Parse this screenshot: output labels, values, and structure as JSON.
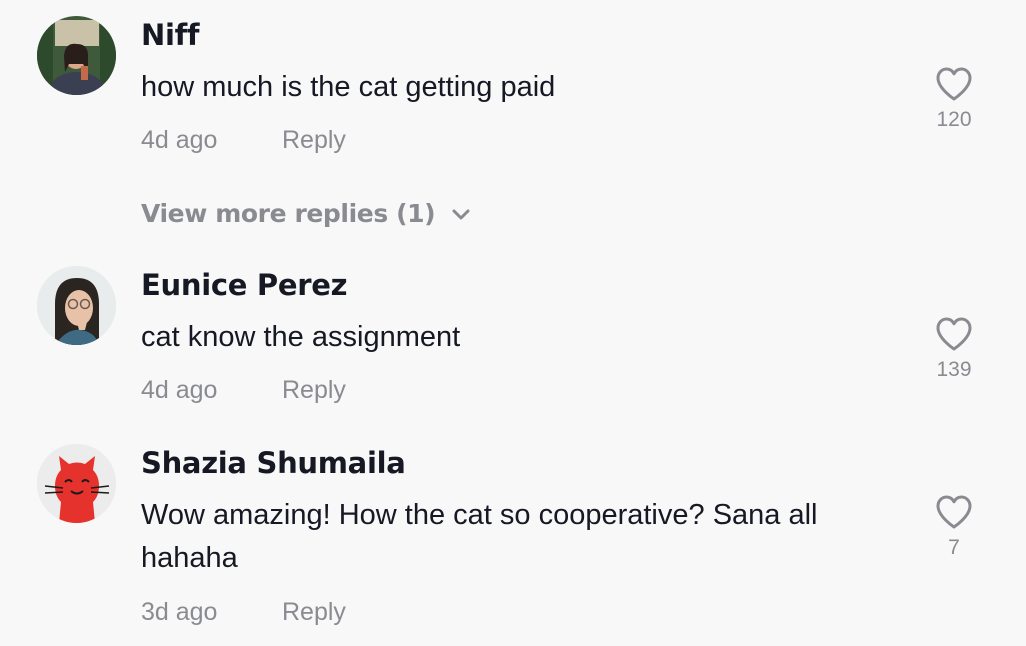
{
  "comments": [
    {
      "author": "Niff",
      "text": "how much is the cat getting paid",
      "time": "4d ago",
      "reply_label": "Reply",
      "likes": "120"
    },
    {
      "author": "Eunice Perez",
      "text": "cat know the assignment",
      "time": "4d ago",
      "reply_label": "Reply",
      "likes": "139"
    },
    {
      "author": "Shazia Shumaila",
      "text": "Wow amazing! How the cat so cooperative? Sana all hahaha",
      "time": "3d ago",
      "reply_label": "Reply",
      "likes": "7"
    }
  ],
  "view_more_replies": "View more replies (1)",
  "colors": {
    "background": "#f8f8f8",
    "primary_text": "#161823",
    "secondary_text": "#8a8b91"
  }
}
